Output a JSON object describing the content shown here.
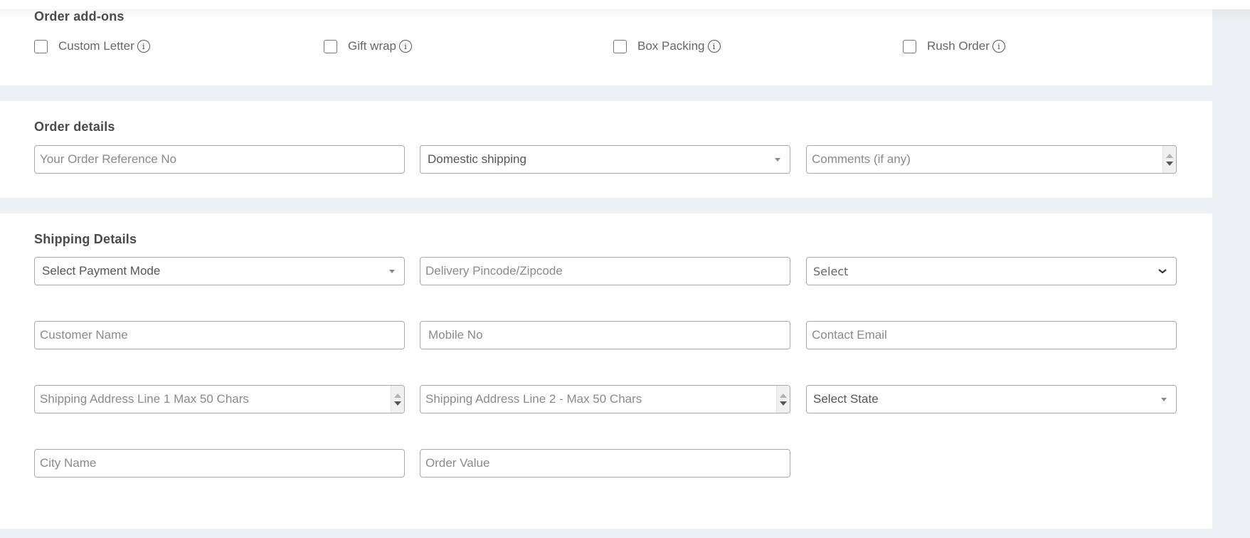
{
  "addons": {
    "title": "Order add-ons",
    "items": [
      {
        "label": "Custom Letter",
        "checked": false,
        "icon": "info-icon"
      },
      {
        "label": "Gift wrap",
        "checked": false,
        "icon": "info-icon"
      },
      {
        "label": "Box Packing",
        "checked": false,
        "icon": "info-icon"
      },
      {
        "label": "Rush Order",
        "checked": false,
        "icon": "info-icon"
      }
    ],
    "info_glyph": "i"
  },
  "order_details": {
    "title": "Order details",
    "reference_placeholder": "Your Order Reference No",
    "shipping_type_selected": "Domestic shipping",
    "comments_placeholder": "Comments (if any)"
  },
  "shipping_details": {
    "title": "Shipping Details",
    "payment_mode_selected": "Select Payment Mode",
    "pincode_placeholder": "Delivery Pincode/Zipcode",
    "select_selected": "Select",
    "customer_name_placeholder": "Customer Name",
    "mobile_placeholder": "Mobile No",
    "email_placeholder": "Contact Email",
    "address1_placeholder": "Shipping Address Line 1 Max 50 Chars",
    "address2_placeholder": "Shipping Address Line 2 - Max 50 Chars",
    "state_selected": "Select State",
    "city_placeholder": "City Name",
    "order_value_placeholder": "Order Value"
  },
  "colors": {
    "page_background": "#edf0f4",
    "panel_background": "#ffffff",
    "heading_text": "#4a4a4a",
    "placeholder_text": "#8a8a8a",
    "border": "#a9a9a9"
  }
}
